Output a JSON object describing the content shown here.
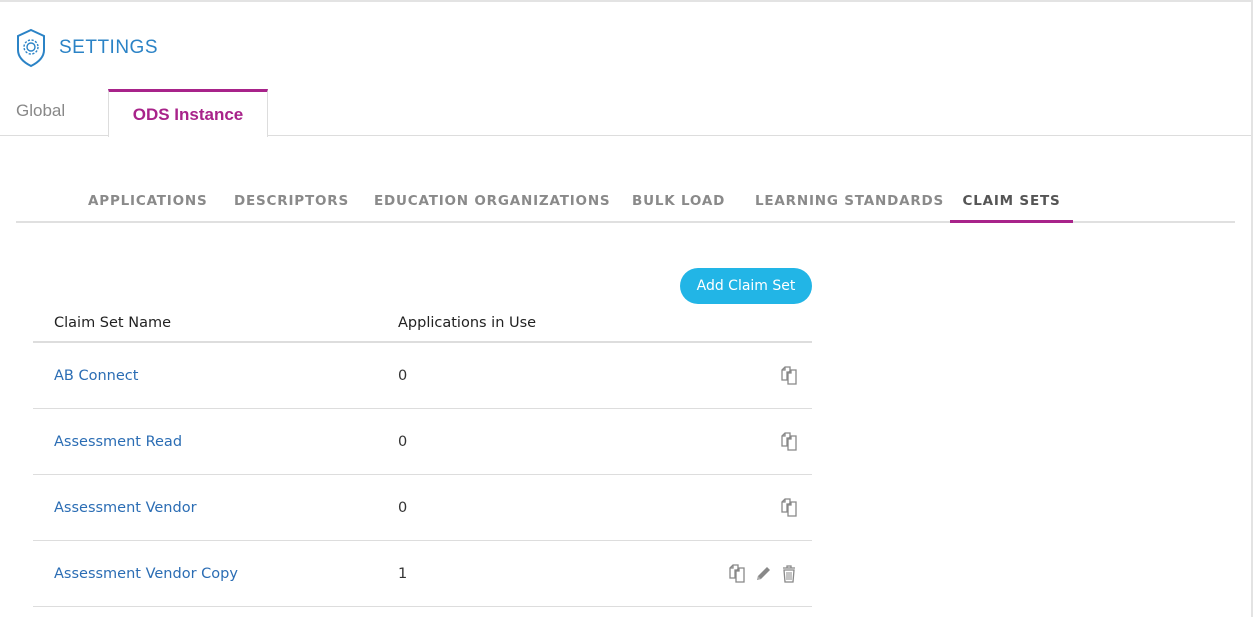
{
  "header": {
    "title": "SETTINGS",
    "icon": "shield-gear-icon"
  },
  "top_tabs": [
    {
      "label": "Global",
      "active": false
    },
    {
      "label": "ODS Instance",
      "active": true
    }
  ],
  "sub_tabs": [
    {
      "label": "APPLICATIONS",
      "active": false
    },
    {
      "label": "DESCRIPTORS",
      "active": false
    },
    {
      "label": "EDUCATION ORGANIZATIONS",
      "active": false
    },
    {
      "label": "BULK LOAD",
      "active": false
    },
    {
      "label": "LEARNING STANDARDS",
      "active": false
    },
    {
      "label": "CLAIM SETS",
      "active": true
    }
  ],
  "add_button": {
    "label": "Add Claim Set"
  },
  "table": {
    "columns": [
      "Claim Set Name",
      "Applications in Use"
    ],
    "rows": [
      {
        "name": "AB Connect",
        "count": "0",
        "actions": [
          "copy-icon"
        ]
      },
      {
        "name": "Assessment Read",
        "count": "0",
        "actions": [
          "copy-icon"
        ]
      },
      {
        "name": "Assessment Vendor",
        "count": "0",
        "actions": [
          "copy-icon"
        ]
      },
      {
        "name": "Assessment Vendor Copy",
        "count": "1",
        "actions": [
          "copy-icon",
          "pencil-icon",
          "trash-icon"
        ]
      }
    ]
  },
  "colors": {
    "accent": "#a8238a",
    "link": "#2b6db4",
    "button": "#22b5e6",
    "title": "#2b83c6"
  }
}
